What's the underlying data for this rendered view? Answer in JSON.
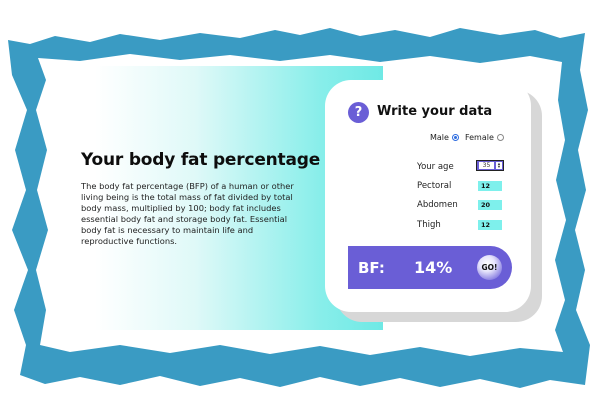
{
  "hero": {
    "title": "Your body fat percentage",
    "description": "The body fat percentage (BFP) of a human or other living being is the total mass of fat divided by total body mass, multiplied by 100; body fat includes essential body fat and storage body fat. Essential body fat is necessary to maintain life and reproductive functions."
  },
  "form": {
    "icon_glyph": "?",
    "title": "Write your data",
    "gender": {
      "male_label": "Male",
      "female_label": "Female",
      "selected": "Male"
    },
    "fields": {
      "age": {
        "label": "Your age",
        "value": "35"
      },
      "pectoral": {
        "label": "Pectoral",
        "value": "12"
      },
      "abdomen": {
        "label": "Abdomen",
        "value": "20"
      },
      "thigh": {
        "label": "Thigh",
        "value": "12"
      }
    }
  },
  "result": {
    "label": "BF:",
    "value": "14%",
    "go_label": "GO!"
  },
  "colors": {
    "frame": "#3a9bc3",
    "accent": "#6a5ed6",
    "input_fill": "#7ef0ec",
    "gradient_end": "#6fe9e5"
  },
  "icons": {
    "help": "question-icon",
    "spinner": "spinner-icon"
  }
}
